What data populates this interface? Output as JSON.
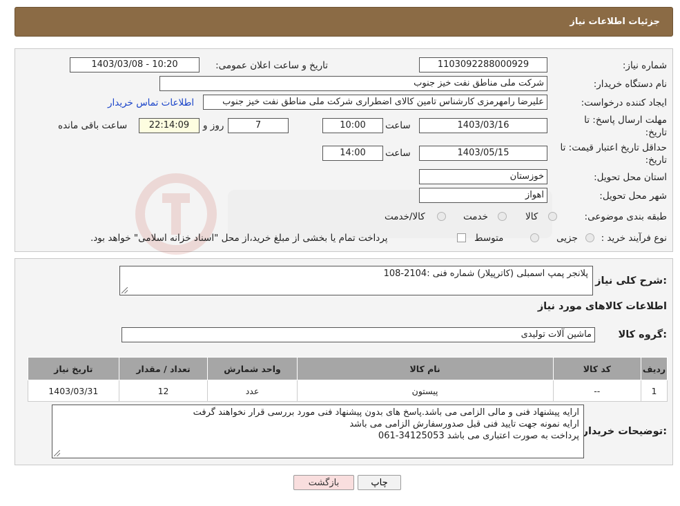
{
  "header": {
    "title": "جزئیات اطلاعات نیاز"
  },
  "info": {
    "need_number_label": "شماره نیاز:",
    "need_number": "1103092288000929",
    "announce_label": "تاریخ و ساعت اعلان عمومی:",
    "announce_value": "1403/03/08 - 10:20",
    "buyer_label": "نام دستگاه خریدار:",
    "buyer_value": "شرکت ملی مناطق نفت خیز جنوب",
    "creator_label": "ایجاد کننده درخواست:",
    "creator_value": "علیرضا رامهرمزی کارشناس تامین کالای اضطراری شرکت ملی مناطق نفت خیز جنوب",
    "contact_link": "اطلاعات تماس خریدار",
    "deadline_label": "مهلت ارسال پاسخ: تا تاریخ:",
    "deadline_date": "1403/03/16",
    "time_label": "ساعت",
    "deadline_time": "10:00",
    "days_value": "7",
    "days_label": "روز و",
    "remaining_time": "22:14:09",
    "remaining_label": "ساعت باقی مانده",
    "validity_label": "حداقل تاریخ اعتبار قیمت: تا تاریخ:",
    "validity_date": "1403/05/15",
    "validity_time": "14:00",
    "province_label": "استان محل تحویل:",
    "province_value": "خوزستان",
    "city_label": "شهر محل تحویل:",
    "city_value": "اهواز",
    "category_label": "طبقه بندی موضوعی:",
    "category_options": [
      "کالا",
      "خدمت",
      "کالا/خدمت"
    ],
    "process_label": "نوع فرآیند خرید :",
    "process_options": [
      "جزیی",
      "متوسط"
    ],
    "payment_note": "پرداخت تمام یا بخشی از مبلغ خرید،از محل \"اسناد خزانه اسلامی\" خواهد بود."
  },
  "summary": {
    "label": "شرح کلی نیاز:",
    "value": "پلانجر پمپ اسمبلی (کاترپیلار) شماره فنی :2104-108"
  },
  "goods": {
    "section_title": "اطلاعات کالاهای مورد نیاز",
    "group_label": "گروه کالا:",
    "group_value": "ماشین آلات تولیدی"
  },
  "table": {
    "headers": [
      "ردیف",
      "کد کالا",
      "نام کالا",
      "واحد شمارش",
      "تعداد / مقدار",
      "تاریخ نیاز"
    ],
    "rows": [
      [
        "1",
        "--",
        "پیستون",
        "عدد",
        "12",
        "1403/03/31"
      ]
    ]
  },
  "notes": {
    "label": "توضیحات خریدار:",
    "lines": [
      "ارایه پیشنهاد فنی و مالی الزامی می باشد.پاسخ های بدون پیشنهاد فنی مورد بررسی قرار نخواهند گرفت",
      "ارایه نمونه جهت تایید فنی قبل صدورسفارش الزامی می باشد",
      "پرداخت به صورت اعتباری می باشد 34125053-061"
    ]
  },
  "buttons": {
    "print": "چاپ",
    "back": "بازگشت"
  },
  "colors": {
    "header_bg": "#8b6b45",
    "panel_bg": "#f4f4f4",
    "table_header_bg": "#a6a6a6",
    "back_button_bg": "#f9dede"
  }
}
